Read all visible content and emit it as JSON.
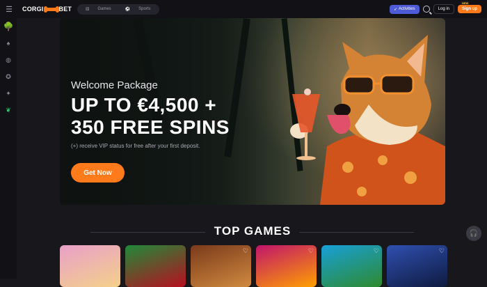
{
  "header": {
    "logo_left": "CORGI",
    "logo_right": "BET",
    "tabs": [
      {
        "label": "Games",
        "icon": "dice-icon"
      },
      {
        "label": "Sports",
        "icon": "ball-icon"
      }
    ],
    "activities_label": "Activities",
    "login_label": "Log in",
    "signup_label": "Sign up",
    "signup_badge": "NEW"
  },
  "sidebar": {
    "icons": [
      "tree-icon",
      "cards-icon",
      "basketball-icon",
      "soccer-icon",
      "gamepad-icon",
      "leaf-icon"
    ]
  },
  "hero": {
    "package": "Welcome Package",
    "headline_line1": "UP TO €4,500 +",
    "headline_line2": "350 FREE SPINS",
    "subtext": "(+) receive VIP status for free after your first deposit.",
    "cta": "Get Now"
  },
  "top_games": {
    "title": "TOP GAMES",
    "cards": [
      {
        "name": "zeus-game",
        "color1": "#e8a0c8",
        "color2": "#f4d08a"
      },
      {
        "name": "100-game",
        "color1": "#1f8a3a",
        "color2": "#b80f1e"
      },
      {
        "name": "cowboy-game",
        "color1": "#7a3a1a",
        "color2": "#d08a40"
      },
      {
        "name": "chicken-game",
        "color1": "#c0146a",
        "color2": "#ffa000"
      },
      {
        "name": "frog-game",
        "color1": "#18a0d8",
        "color2": "#2e8a2e"
      },
      {
        "name": "storm-game",
        "color1": "#3050b0",
        "color2": "#0e1a40"
      }
    ]
  },
  "colors": {
    "accent": "#ff7a1a",
    "activities": "#4d5bd6",
    "background": "#17171c"
  }
}
